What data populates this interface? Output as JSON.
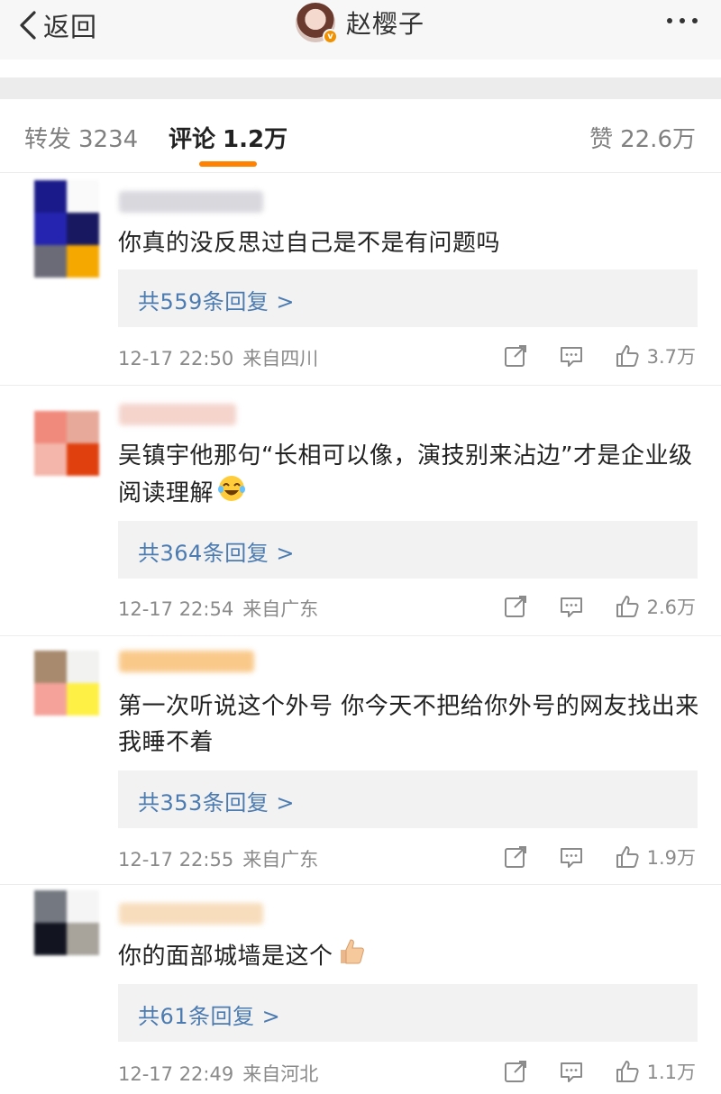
{
  "nav": {
    "back_label": "返回",
    "profile_name": "赵樱子",
    "verified_badge": "v",
    "more_icon": "more-dots-icon"
  },
  "tabs": {
    "repost": {
      "label": "转发",
      "count": "3234"
    },
    "comment": {
      "label": "评论",
      "count": "1.2万"
    },
    "like": {
      "label": "赞",
      "count": "22.6万"
    }
  },
  "colors": {
    "accent": "#ff8200",
    "link": "#4b7bb0",
    "reply_bg": "#f2f2f2",
    "meta": "#8a8a8a"
  },
  "comments": [
    {
      "text": "你真的没反思过自己是不是有问题吗",
      "replies": "共559条回复 >",
      "time": "12-17 22:50",
      "location": "来自四川",
      "likes": "3.7万"
    },
    {
      "text": "吴镇宇他那句“长相可以像，演技别来沾边”才是企业级阅读理解",
      "emoji": "laughing-tears-emoji",
      "replies": "共364条回复 >",
      "time": "12-17 22:54",
      "location": "来自广东",
      "likes": "2.6万"
    },
    {
      "text": "第一次听说这个外号 你今天不把给你外号的网友找出来 我睡不着",
      "replies": "共353条回复 >",
      "time": "12-17 22:55",
      "location": "来自广东",
      "likes": "1.9万"
    },
    {
      "text": "你的面部城墙是这个",
      "emoji": "thumbs-up-emoji",
      "replies": "共61条回复 >",
      "time": "12-17 22:49",
      "location": "来自河北",
      "likes": "1.1万"
    }
  ]
}
